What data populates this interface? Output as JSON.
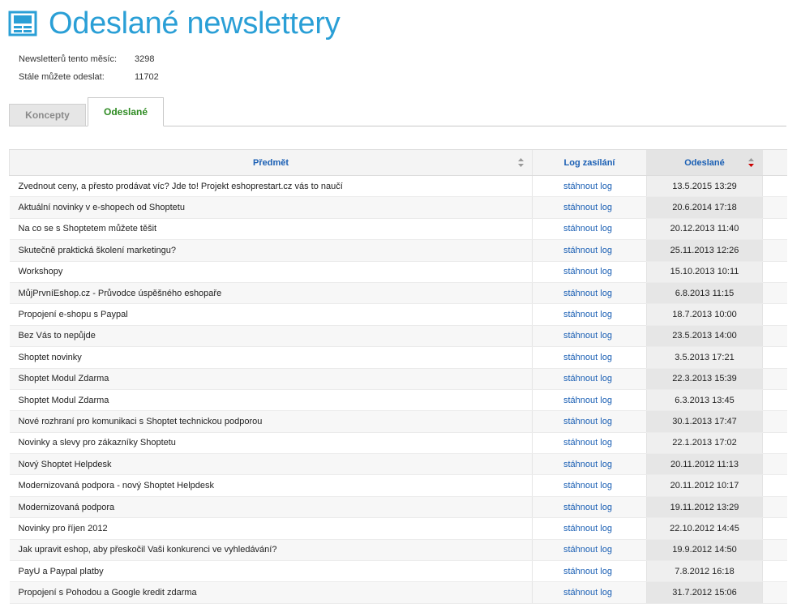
{
  "header": {
    "title": "Odeslané newslettery",
    "icon": "newsletter-icon"
  },
  "stats": [
    {
      "label": "Newsletterů tento měsíc:",
      "value": "3298"
    },
    {
      "label": "Stále můžete odeslat:",
      "value": "11702"
    }
  ],
  "tabs": [
    {
      "label": "Koncepty",
      "active": false
    },
    {
      "label": "Odeslané",
      "active": true
    }
  ],
  "table": {
    "columns": {
      "subject": "Předmět",
      "log": "Log zasílání",
      "sent": "Odeslané"
    },
    "log_link": "stáhnout log",
    "rows": [
      {
        "subject": "Zvednout ceny, a přesto prodávat víc? Jde to! Projekt eshoprestart.cz vás to naučí",
        "sent": "13.5.2015 13:29"
      },
      {
        "subject": "Aktuální novinky v e-shopech od Shoptetu",
        "sent": "20.6.2014 17:18"
      },
      {
        "subject": "Na co se s Shoptetem můžete těšit",
        "sent": "20.12.2013 11:40"
      },
      {
        "subject": "Skutečně praktická školení marketingu?",
        "sent": "25.11.2013 12:26"
      },
      {
        "subject": "Workshopy",
        "sent": "15.10.2013 10:11"
      },
      {
        "subject": "MůjPrvníEshop.cz - Průvodce úspěšného eshopaře",
        "sent": "6.8.2013 11:15"
      },
      {
        "subject": "Propojení e-shopu s Paypal",
        "sent": "18.7.2013 10:00"
      },
      {
        "subject": "Bez Vás to nepůjde",
        "sent": "23.5.2013 14:00"
      },
      {
        "subject": "Shoptet novinky",
        "sent": "3.5.2013 17:21"
      },
      {
        "subject": "Shoptet Modul Zdarma",
        "sent": "22.3.2013 15:39"
      },
      {
        "subject": "Shoptet Modul Zdarma",
        "sent": "6.3.2013 13:45"
      },
      {
        "subject": "Nové rozhraní pro komunikaci s Shoptet technickou podporou",
        "sent": "30.1.2013 17:47"
      },
      {
        "subject": "Novinky a slevy pro zákazníky Shoptetu",
        "sent": "22.1.2013 17:02"
      },
      {
        "subject": "Nový Shoptet Helpdesk",
        "sent": "20.11.2012 11:13"
      },
      {
        "subject": "Modernizovaná podpora - nový Shoptet Helpdesk",
        "sent": "20.11.2012 10:17"
      },
      {
        "subject": "Modernizovaná podpora",
        "sent": "19.11.2012 13:29"
      },
      {
        "subject": "Novinky pro říjen 2012",
        "sent": "22.10.2012 14:45"
      },
      {
        "subject": "Jak upravit eshop, aby přeskočil Vaši konkurenci ve vyhledávání?",
        "sent": "19.9.2012 14:50"
      },
      {
        "subject": "PayU a Paypal platby",
        "sent": "7.8.2012 16:18"
      },
      {
        "subject": "Propojení s Pohodou a Google kredit zdarma",
        "sent": "31.7.2012 15:06"
      }
    ]
  },
  "colors": {
    "title": "#2a9fd6",
    "link": "#1a5fb4",
    "active_tab": "#2e8b22",
    "sort_active": "#cc0000"
  }
}
